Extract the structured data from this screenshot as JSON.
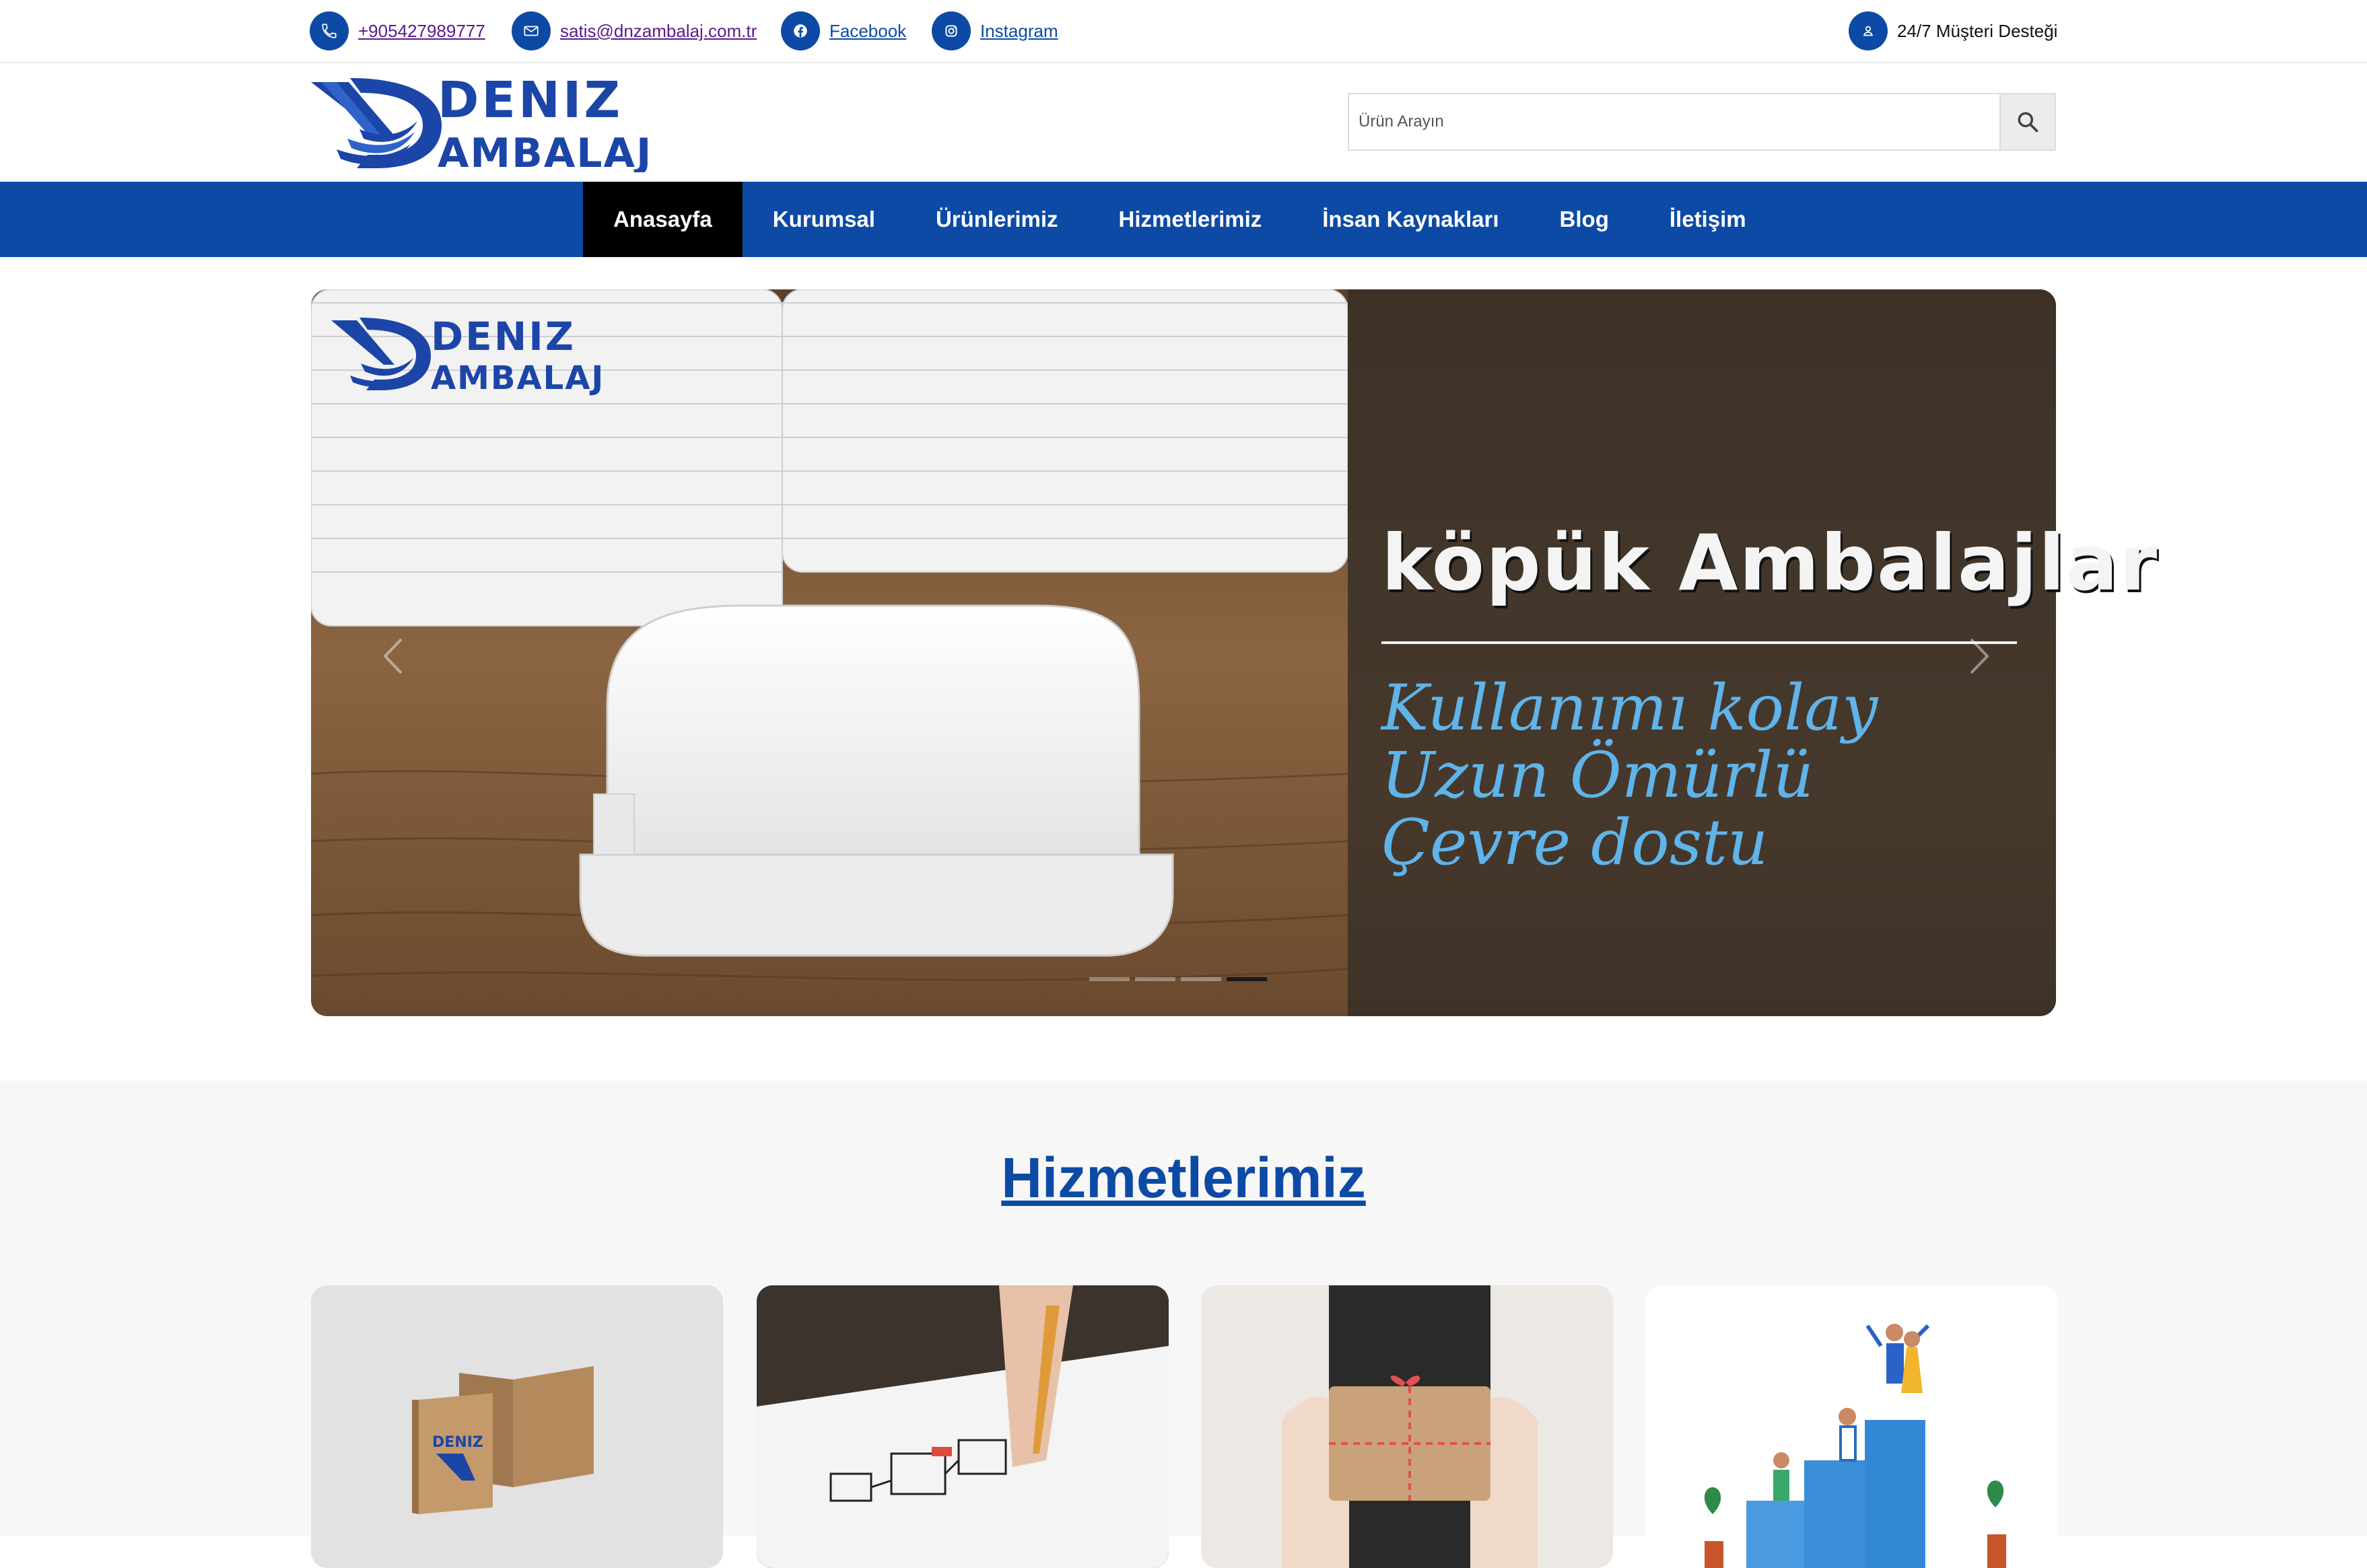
{
  "topbar": {
    "phone": "+905427989777",
    "email": "satis@dnzambalaj.com.tr",
    "facebook": "Facebook",
    "instagram": "Instagram",
    "support": "24/7 Müşteri Desteği"
  },
  "logo": {
    "line1": "DENIZ",
    "line2": "AMBALAJ"
  },
  "search": {
    "placeholder": "Ürün Arayın",
    "value": ""
  },
  "nav": {
    "items": [
      "Anasayfa",
      "Kurumsal",
      "Ürünlerimiz",
      "Hizmetlerimiz",
      "İnsan Kaynakları",
      "Blog",
      "İletişim"
    ],
    "active_index": 0
  },
  "slider": {
    "title": "köpük Ambalajlar",
    "lines": [
      "Kullanımı kolay",
      "Uzun Ömürlü",
      "Çevre dostu"
    ],
    "active_slide": 4,
    "slide_count": 4
  },
  "services": {
    "heading": "Hizmetlerimiz",
    "cards": [
      {
        "icon": "packaging-boxes-image"
      },
      {
        "icon": "design-sketch-image"
      },
      {
        "icon": "gift-package-image"
      },
      {
        "icon": "growth-team-image"
      }
    ]
  },
  "colors": {
    "brand": "#0d4aa6",
    "nav_active": "#000000",
    "slide_accent": "#5fb4ea"
  }
}
